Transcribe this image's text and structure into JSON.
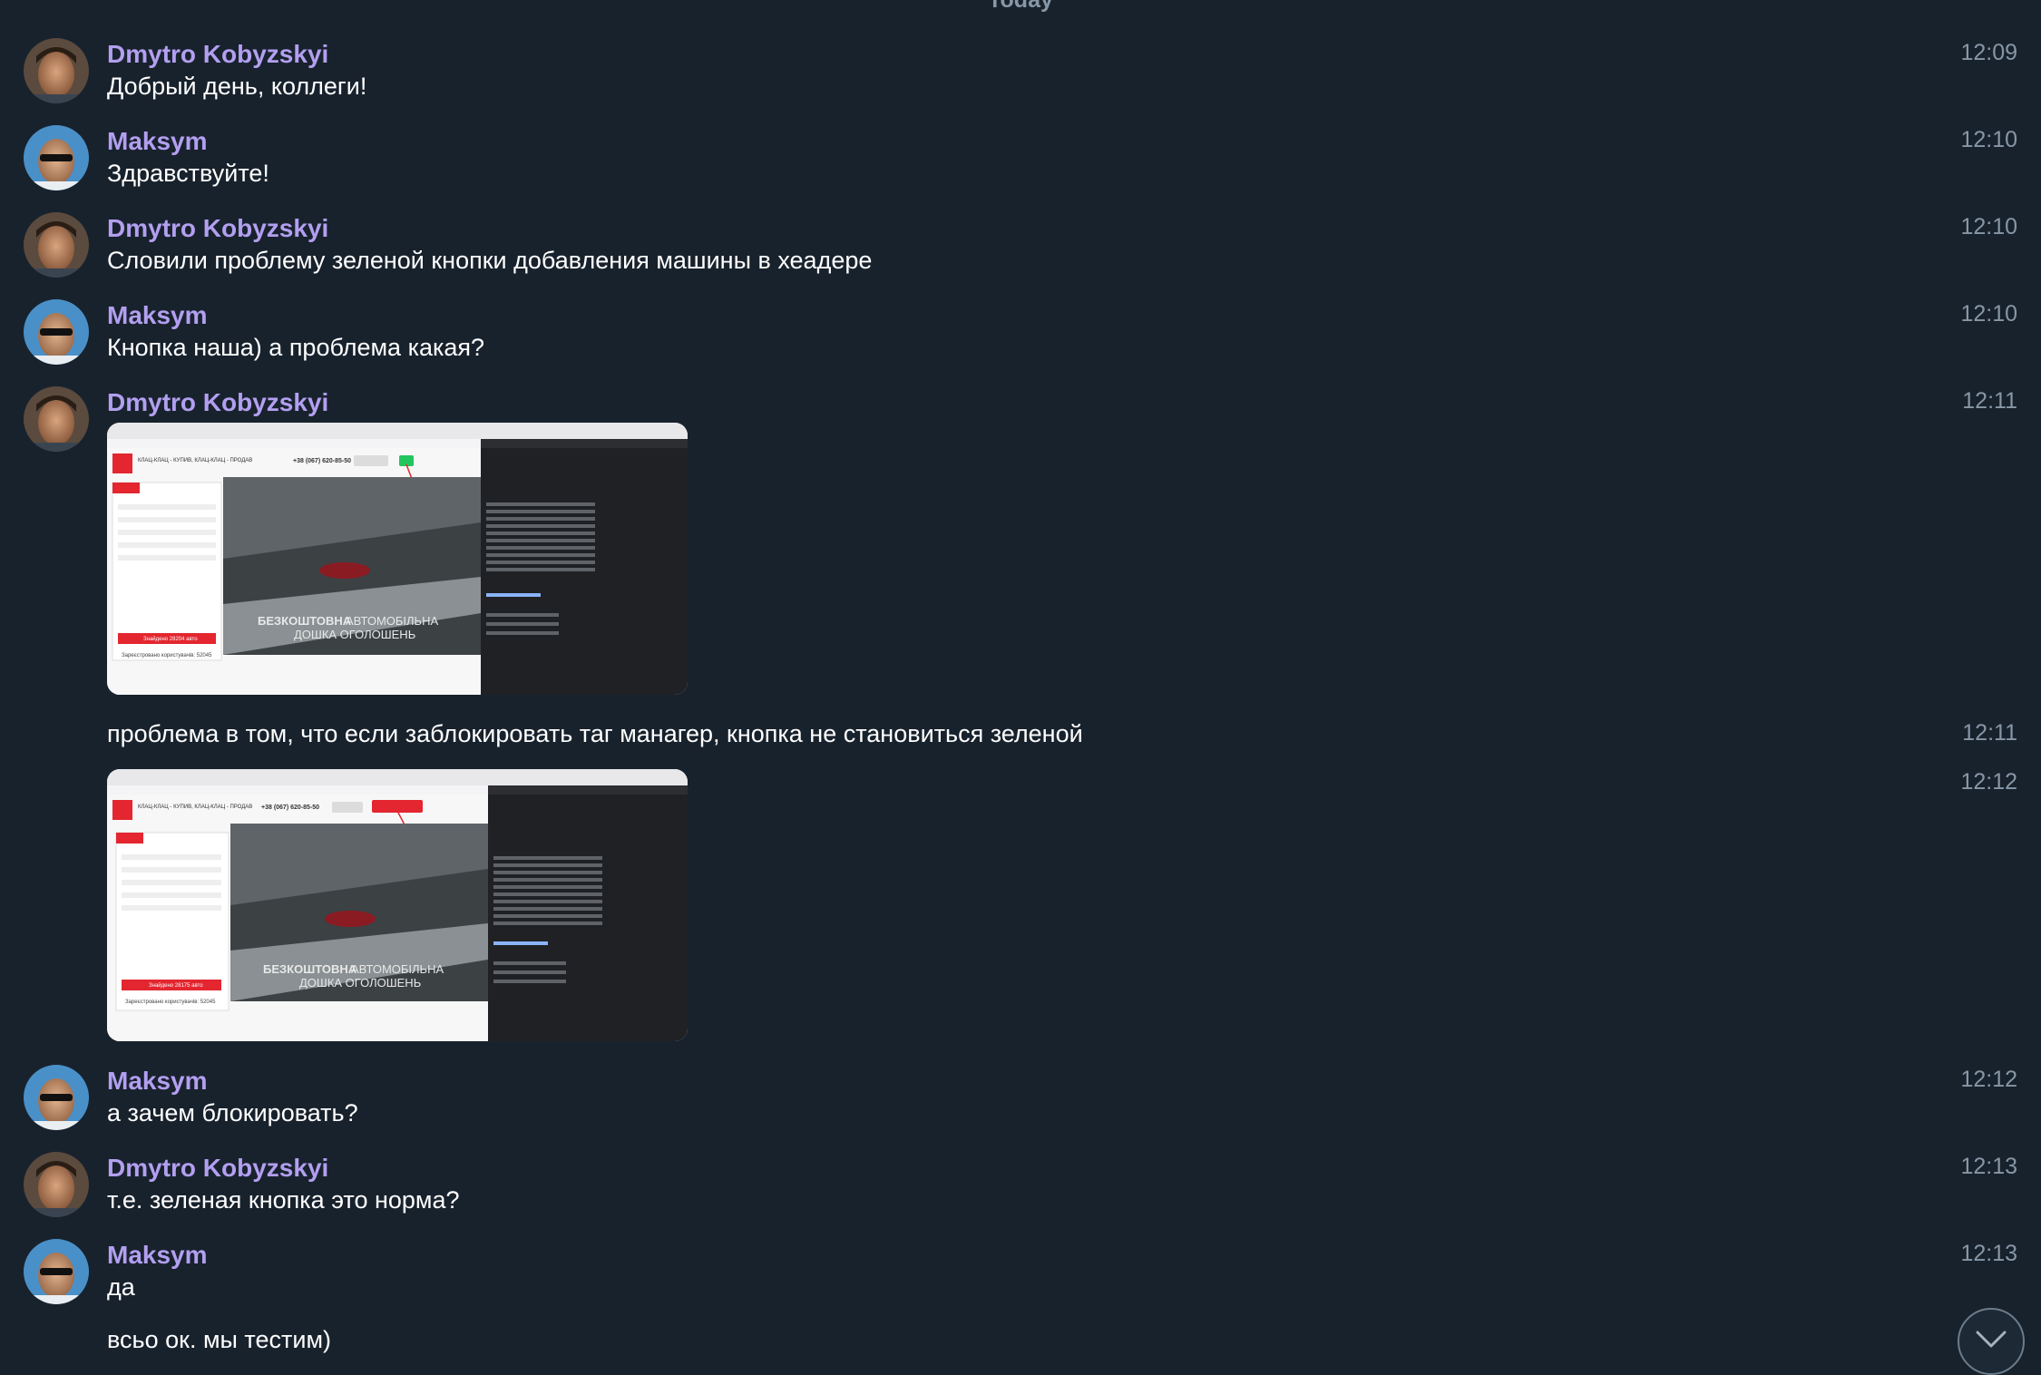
{
  "date_separator": "Today",
  "messages": [
    {
      "sender": "Dmytro Kobyzskyi",
      "text": "Добрый день, коллеги!",
      "time": "12:09"
    },
    {
      "sender": "Maksym",
      "text": "Здравствуйте!",
      "time": "12:10"
    },
    {
      "sender": "Dmytro Kobyzskyi",
      "text": "Словили проблему зеленой кнопки добавления машины в хеадере",
      "time": "12:10"
    },
    {
      "sender": "Maksym",
      "text": "Кнопка наша) а проблема какая?",
      "time": "12:10"
    },
    {
      "sender": "Dmytro Kobyzskyi",
      "time": "12:11"
    },
    {
      "text": "проблема в том, что если заблокировать таг манагер, кнопка не становиться зеленой",
      "time": "12:11"
    },
    {
      "time": "12:12"
    },
    {
      "sender": "Maksym",
      "text": "а зачем блокировать?",
      "time": "12:12"
    },
    {
      "sender": "Dmytro Kobyzskyi",
      "text": "т.е. зеленая кнопка это норма?",
      "time": "12:13"
    },
    {
      "sender": "Maksym",
      "text": "да",
      "time": "12:13"
    },
    {
      "text": "всьо ок. мы тестим)"
    }
  ],
  "screenshots": [
    {
      "hero_line1": "БЕЗКОШТОВНА",
      "hero_line1b": "АВТОМОБІЛЬНА",
      "hero_line2": "ДОШКА ОГОЛОШЕНЬ",
      "phone": "+38 (067) 620-85-50",
      "search_button": "Знайдено 28204 авто",
      "registered": "Зареєстровано користувачів: 52045",
      "brand": "КЛАЦ-КЛАЦ - КУПИВ, КЛАЦ-КЛАЦ - ПРОДАВ"
    },
    {
      "hero_line1": "БЕЗКОШТОВНА",
      "hero_line1b": "АВТОМОБІЛЬНА",
      "hero_line2": "ДОШКА ОГОЛОШЕНЬ",
      "phone": "+38 (067) 620-85-50",
      "search_button": "Знайдено 28175 авто",
      "registered": "Зареєстровано користувачів: 52045",
      "brand": "КЛАЦ-КЛАЦ - КУПИВ, КЛАЦ-КЛАЦ - ПРОДАВ"
    }
  ],
  "colors": {
    "background": "#18222d",
    "sender": "#b39ff0",
    "time": "#8797a6",
    "accent_green": "#22c55e",
    "accent_red": "#e3262f"
  },
  "icons": {
    "scroll_down": "chevron-down-icon"
  }
}
